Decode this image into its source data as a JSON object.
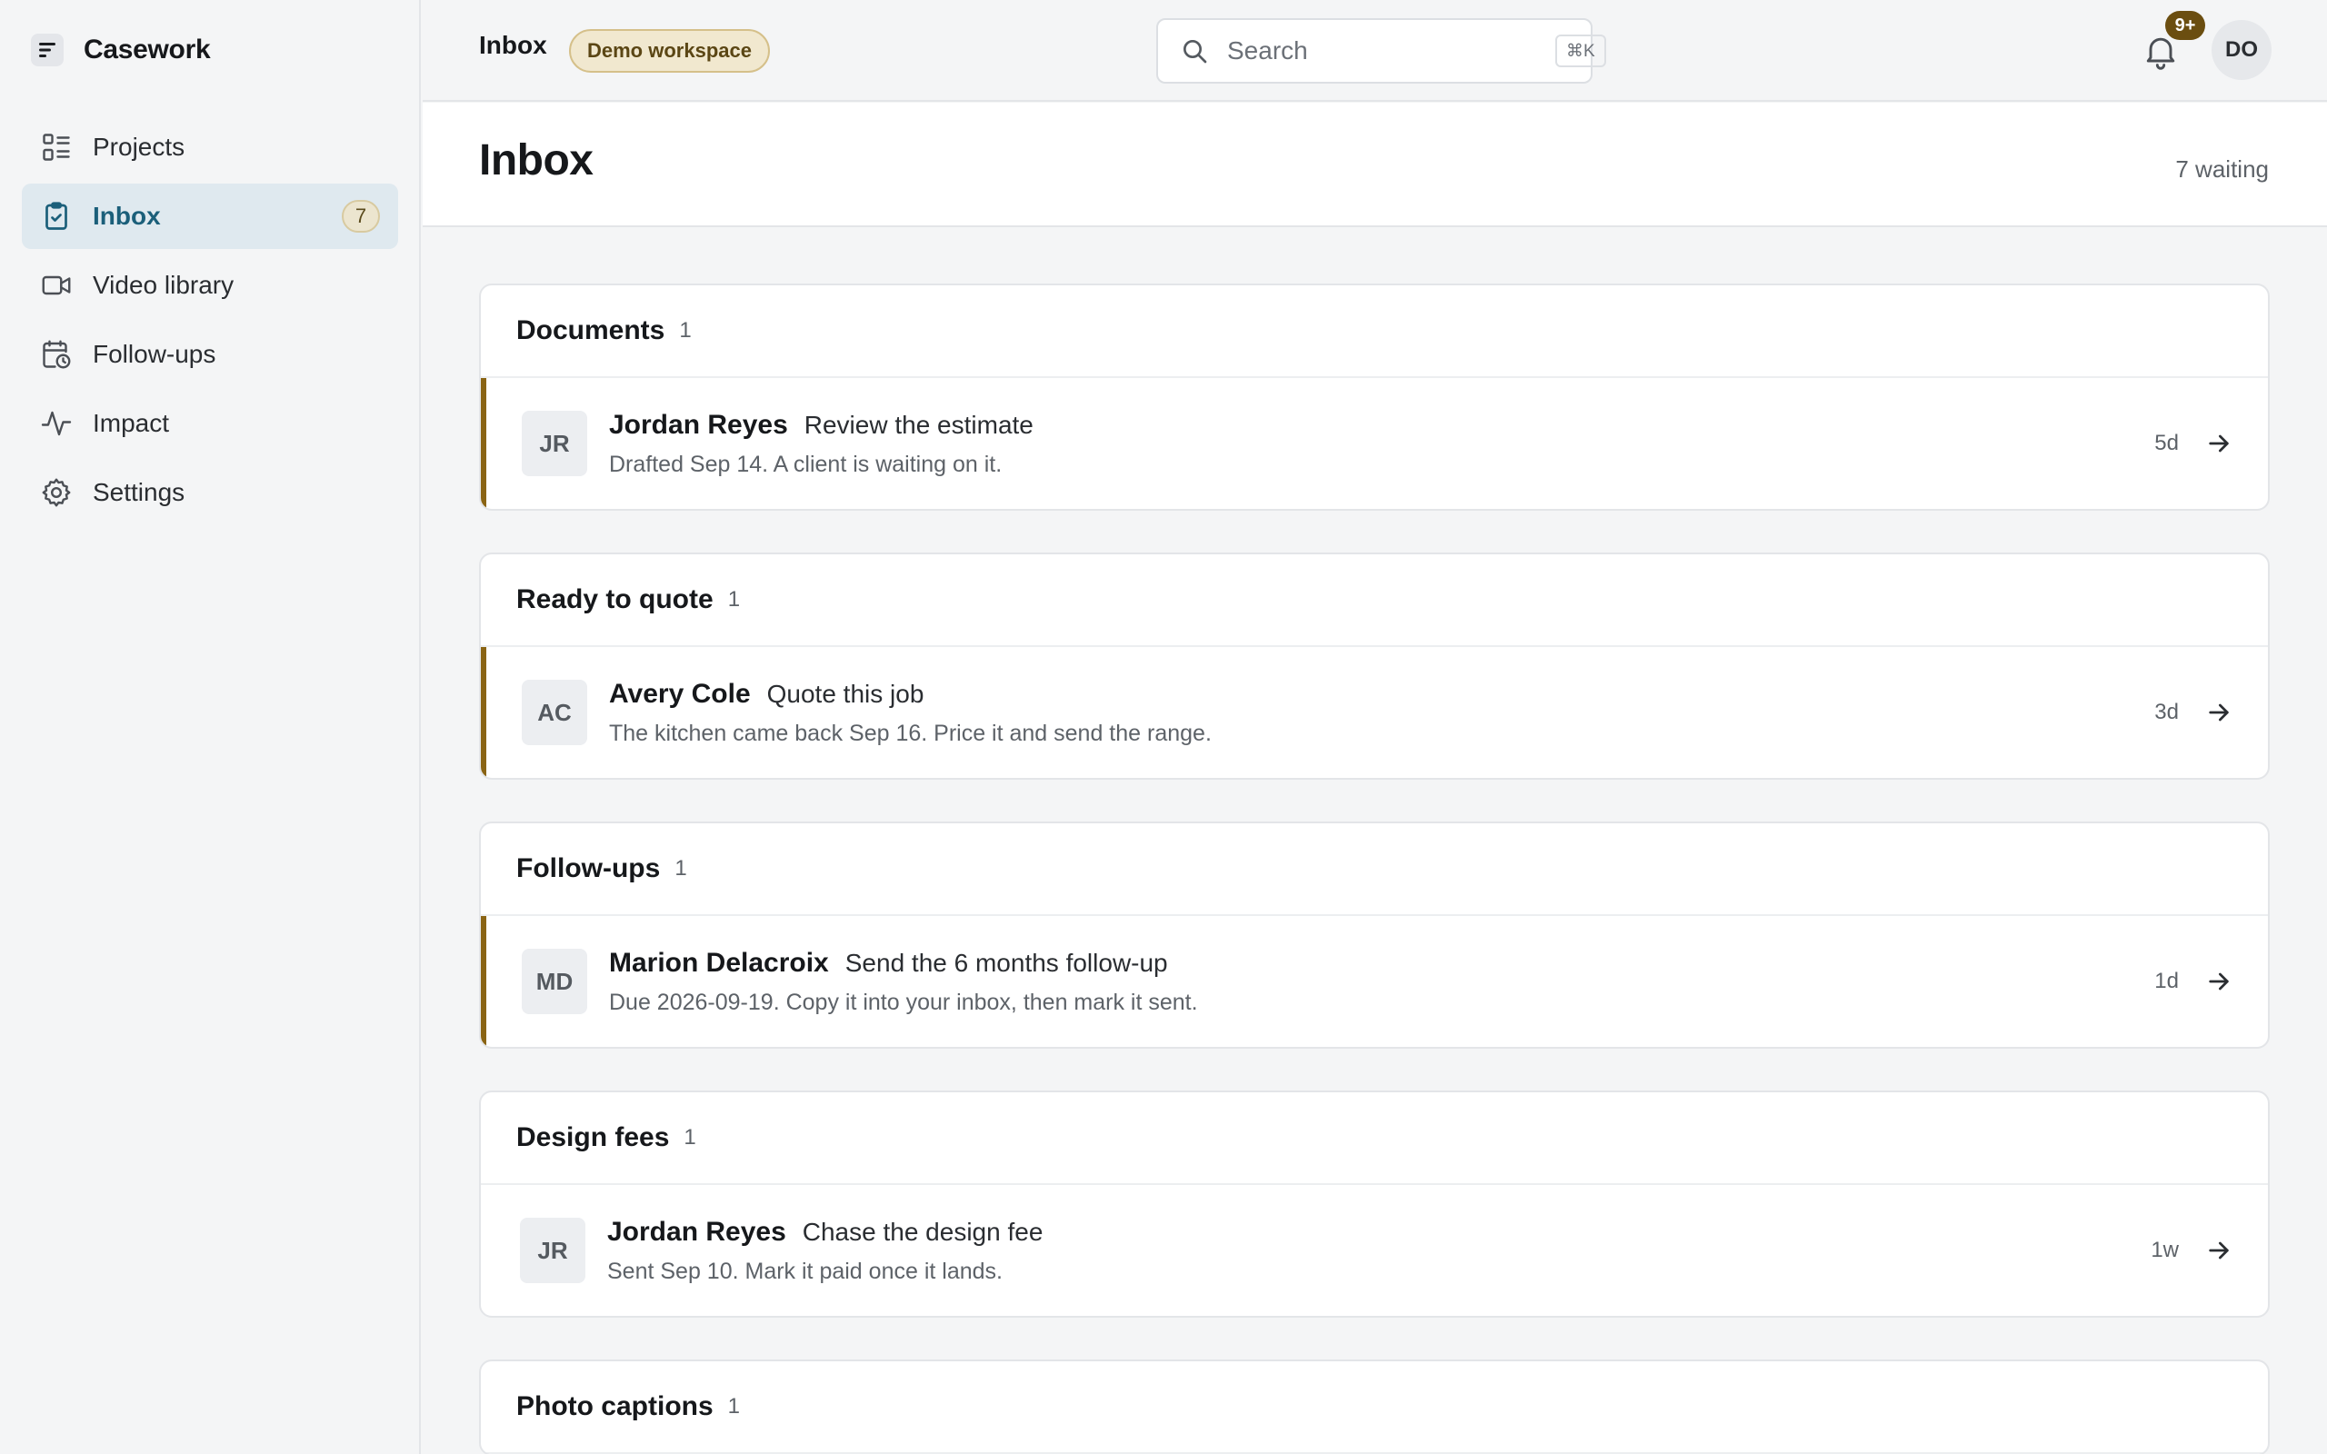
{
  "brand": {
    "name": "Casework",
    "logo_icon": "brand-logo-icon"
  },
  "sidebar": {
    "items": [
      {
        "label": "Projects",
        "icon": "grid-list-icon",
        "active": false
      },
      {
        "label": "Inbox",
        "icon": "clipboard-check-icon",
        "active": true,
        "badge": "7"
      },
      {
        "label": "Video library",
        "icon": "video-camera-icon",
        "active": false
      },
      {
        "label": "Follow-ups",
        "icon": "calendar-clock-icon",
        "active": false
      },
      {
        "label": "Impact",
        "icon": "activity-icon",
        "active": false
      },
      {
        "label": "Settings",
        "icon": "gear-icon",
        "active": false
      }
    ]
  },
  "topbar": {
    "crumb": "Inbox",
    "workspace_pill": "Demo workspace",
    "search": {
      "placeholder": "Search",
      "shortcut": "⌘K"
    },
    "notifications_badge": "9+",
    "user_initials": "DO"
  },
  "page": {
    "title": "Inbox",
    "waiting": "7 waiting"
  },
  "sections": [
    {
      "title": "Documents",
      "count": "1",
      "rows": [
        {
          "initials": "JR",
          "name": "Jordan Reyes",
          "action": "Review the estimate",
          "sub": "Drafted Sep 14. A client is waiting on it.",
          "age": "5d",
          "flagged": true
        }
      ]
    },
    {
      "title": "Ready to quote",
      "count": "1",
      "rows": [
        {
          "initials": "AC",
          "name": "Avery Cole",
          "action": "Quote this job",
          "sub": "The kitchen came back Sep 16. Price it and send the range.",
          "age": "3d",
          "flagged": true
        }
      ]
    },
    {
      "title": "Follow-ups",
      "count": "1",
      "rows": [
        {
          "initials": "MD",
          "name": "Marion Delacroix",
          "action": "Send the 6 months follow-up",
          "sub": "Due 2026-09-19. Copy it into your inbox, then mark it sent.",
          "age": "1d",
          "flagged": true
        }
      ]
    },
    {
      "title": "Design fees",
      "count": "1",
      "rows": [
        {
          "initials": "JR",
          "name": "Jordan Reyes",
          "action": "Chase the design fee",
          "sub": "Sent Sep 10. Mark it paid once it lands.",
          "age": "1w",
          "flagged": false
        }
      ]
    },
    {
      "title": "Photo captions",
      "count": "1",
      "rows": []
    }
  ],
  "colors": {
    "accent": "#1b5f7a",
    "active_bg": "#dfe9ef",
    "flag": "#8a6414",
    "badge": "#6b4e10"
  }
}
